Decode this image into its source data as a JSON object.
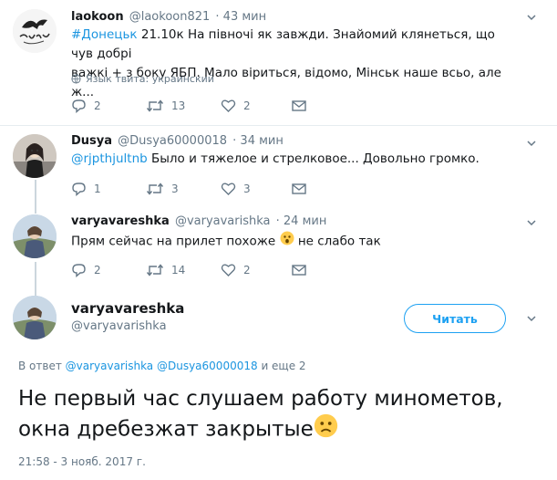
{
  "tweets": [
    {
      "name": "laokoon",
      "handle": "@laokoon821",
      "time": "· 43 мин",
      "hashtag": "#Донецьк",
      "text_rest": " 21.10к На півночі як завжди. Знайомий клянеться, що чув добрі",
      "line2": "важкі + з боку ЯБП. Мало віриться, відомо, Мінськ наше всьо, але ж...",
      "lang": "Язык твита: украинский",
      "reply_count": "2",
      "retweet_count": "13",
      "like_count": "2"
    },
    {
      "name": "Dusya",
      "handle": "@Dusya60000018",
      "time": "· 34 мин",
      "mention": "@rjpthjultnb",
      "text_rest": " Было и тяжелое и стрелковое... Довольно громко.",
      "reply_count": "1",
      "retweet_count": "3",
      "like_count": "3"
    },
    {
      "name": "varyavareshka",
      "handle": "@varyavarishka",
      "time": "· 24 мин",
      "text_a": "Прям сейчас на прилет похоже ",
      "text_b": " не слабо так",
      "reply_count": "2",
      "retweet_count": "14",
      "like_count": "2"
    }
  ],
  "main_tweet": {
    "name": "varyavareshka",
    "handle": "@varyavarishka",
    "follow_label": "Читать",
    "reply_prefix": "В ответ ",
    "reply_user1": "@varyavarishka",
    "reply_user2": "@Dusya60000018",
    "reply_suffix": " и еще 2",
    "text_line1": "Не первый час слушаем работу минометов,",
    "text_line2": "окна дребезжат закрытые",
    "timestamp": "21:58 - 3 нояб. 2017 г."
  },
  "colors": {
    "accent": "#1da1f2",
    "link": "#1b95e0",
    "muted": "#657786",
    "divider": "#e6ecf0"
  },
  "icons": [
    "reply-icon",
    "retweet-icon",
    "like-icon",
    "message-icon",
    "chevron-down-icon",
    "globe-icon"
  ]
}
